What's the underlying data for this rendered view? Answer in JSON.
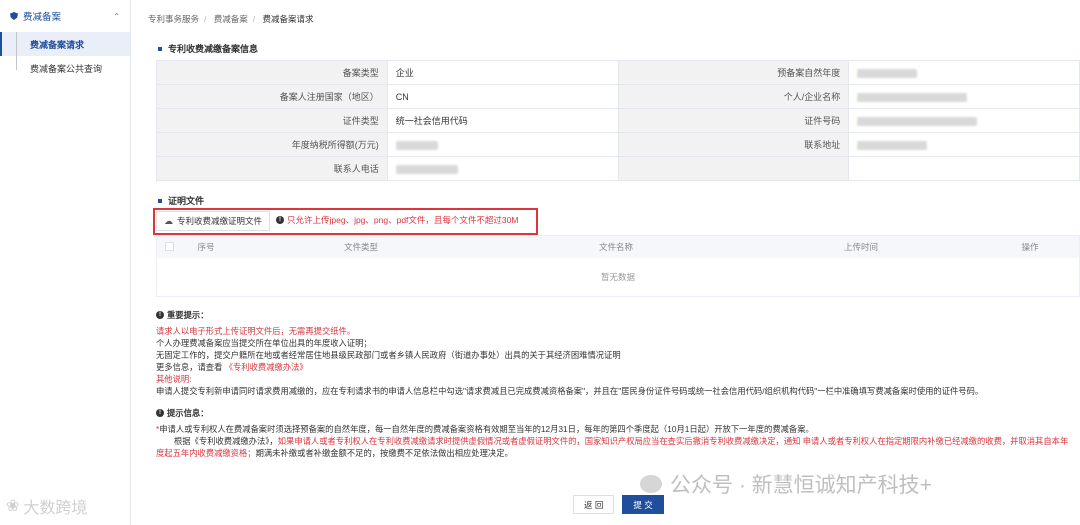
{
  "sidebar": {
    "group_label": "费减备案",
    "items": [
      {
        "label": "费减备案请求"
      },
      {
        "label": "费减备案公共查询"
      }
    ]
  },
  "breadcrumb": [
    "专利事务服务",
    "费减备案",
    "费减备案请求"
  ],
  "info_section": {
    "title": "专利收费减缴备案信息",
    "rows": [
      {
        "l1": "备案类型",
        "v1": "企业",
        "l2": "预备案自然年度"
      },
      {
        "l1": "备案人注册国家（地区）",
        "v1": "CN",
        "l2": "个人/企业名称"
      },
      {
        "l1": "证件类型",
        "v1": "统一社会信用代码",
        "l2": "证件号码"
      },
      {
        "l1": "年度纳税所得额(万元)",
        "v1": "",
        "l2": "联系地址"
      },
      {
        "l1": "联系人电话",
        "v1": "",
        "l2": ""
      }
    ]
  },
  "proof_section": {
    "title": "证明文件",
    "upload_button": "专利收费减缴证明文件",
    "upload_tip": "只允许上传jpeg、jpg、png、pdf文件，且每个文件不超过30M",
    "columns": [
      "序号",
      "文件类型",
      "文件名称",
      "上传时间",
      "操作"
    ],
    "empty_text": "暂无数据"
  },
  "important": {
    "title": "重要提示：",
    "line1": "请求人以电子形式上传证明文件后，无需再提交纸件。",
    "line2": "个人办理费减备案应当提交所在单位出具的年度收入证明；",
    "line3": "无固定工作的，提交户籍所在地或者经常居住地县级民政部门或者乡镇人民政府（街道办事处）出具的关于其经济困难情况证明",
    "line4_prefix": "更多信息，请查看",
    "line4_link": "《专利收费减缴办法》",
    "line5": "其他说明:",
    "line6": "申请人提交专利新申请同时请求费用减缴的，应在专利请求书的申请人信息栏中勾选\"请求费减且已完成费减资格备案\"，并且在\"居民身份证件号码或统一社会信用代码/组织机构代码\"一栏中准确填写费减备案时使用的证件号码。"
  },
  "tips": {
    "title": "提示信息：",
    "line1_star": "*",
    "line1": "申请人或专利权人在费减备案时须选择预备案的自然年度，每一自然年度的费减备案资格有效期至当年的12月31日，每年的第四个季度起（10月1日起）开放下一年度的费减备案。",
    "line2_a": "根据《专利收费减缴办法》，",
    "line2_b": "如果申请人或者专利权人在专利收费减缴请求时提供虚假情况或者虚假证明文件的，国家知识产权局应当在查实后撤消专利收费减缴决定，通知 申请人或者专利权人在指定期限内补缴已经减缴的收费，并取消其自本年度起五年内收费减缴资格；",
    "line2_c": "期满未补缴或者补缴金额不足的，按缴费不足依法做出相应处理决定。"
  },
  "buttons": {
    "back": "返 回",
    "submit": "提 交"
  },
  "watermarks": {
    "right": "公众号 · 新慧恒诚知产科技+",
    "left": "大数跨境"
  }
}
